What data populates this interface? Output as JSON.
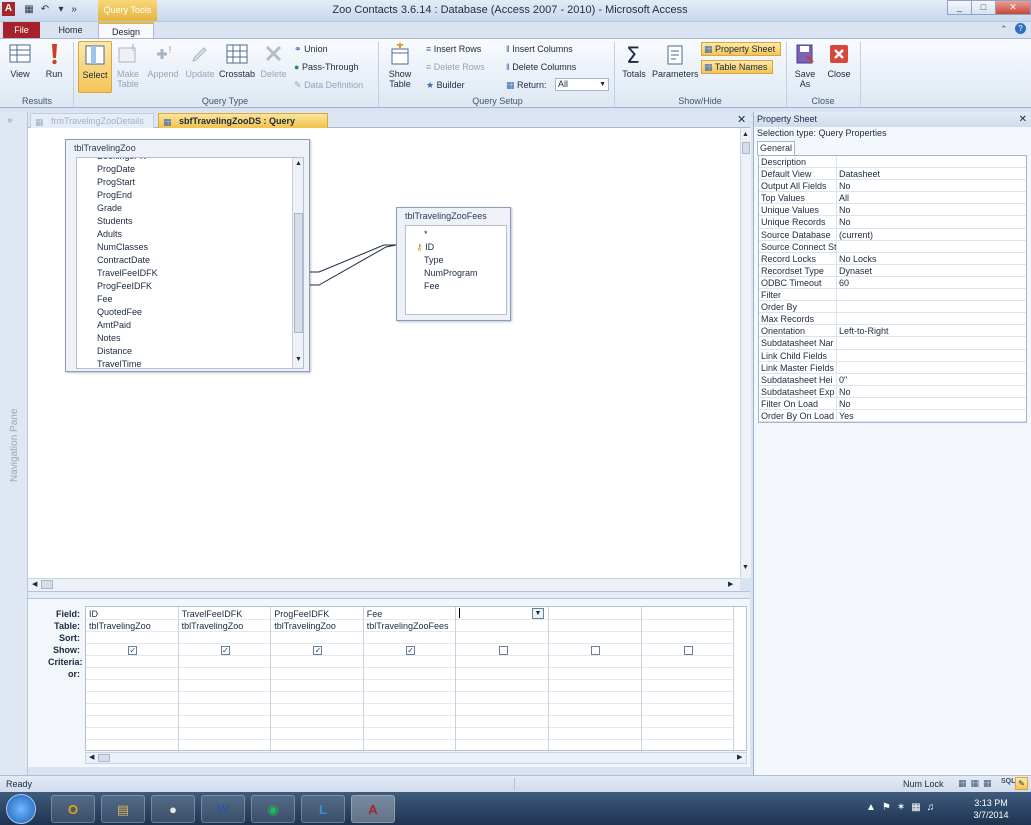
{
  "window": {
    "title": "Zoo Contacts 3.6.14 : Database (Access 2007 - 2010) - Microsoft Access",
    "context_label": "Query Tools",
    "app_letter": "A",
    "controls": [
      "_",
      "□",
      "✕"
    ]
  },
  "tabs": {
    "file": "File",
    "home": "Home",
    "design": "Design"
  },
  "ribbon": {
    "results": {
      "view": "View",
      "run": "Run",
      "group": "Results"
    },
    "query_type": {
      "select": "Select",
      "make_table": "Make Table",
      "append": "Append",
      "update": "Update",
      "crosstab": "Crosstab",
      "delete": "Delete",
      "union": "Union",
      "pass_through": "Pass-Through",
      "data_definition": "Data Definition",
      "group": "Query Type"
    },
    "query_setup": {
      "show_table": "Show Table",
      "insert_rows": "Insert Rows",
      "delete_rows": "Delete Rows",
      "builder": "Builder",
      "insert_columns": "Insert Columns",
      "delete_columns": "Delete Columns",
      "return_label": "Return:",
      "return_value": "All",
      "group": "Query Setup"
    },
    "show_hide": {
      "totals": "Totals",
      "parameters": "Parameters",
      "property_sheet": "Property Sheet",
      "table_names": "Table Names",
      "group": "Show/Hide"
    },
    "close": {
      "save_as": "Save As",
      "close": "Close",
      "group": "Close"
    }
  },
  "nav_pane_label": "Navigation Pane",
  "doc_tabs": [
    "frmTravelingZooDetails",
    "sbfTravelingZooDS : Query Builder"
  ],
  "table1": {
    "title": "tblTravelingZoo",
    "fields": [
      "BookingsPK",
      "ProgDate",
      "ProgStart",
      "ProgEnd",
      "Grade",
      "Students",
      "Adults",
      "NumClasses",
      "ContractDate",
      "TravelFeeIDFK",
      "ProgFeeIDFK",
      "Fee",
      "QuotedFee",
      "AmtPaid",
      "Notes",
      "Distance",
      "TravelTime"
    ]
  },
  "table2": {
    "title": "tblTravelingZooFees",
    "fields": [
      "*",
      "ID",
      "Type",
      "NumProgram",
      "Fee"
    ]
  },
  "grid": {
    "row_labels": [
      "Field:",
      "Table:",
      "Sort:",
      "Show:",
      "Criteria:",
      "or:"
    ],
    "columns": [
      {
        "field": "ID",
        "table": "tblTravelingZoo",
        "show": true
      },
      {
        "field": "TravelFeeIDFK",
        "table": "tblTravelingZoo",
        "show": true
      },
      {
        "field": "ProgFeeIDFK",
        "table": "tblTravelingZoo",
        "show": true
      },
      {
        "field": "Fee",
        "table": "tblTravelingZooFees",
        "show": true
      },
      {
        "field": "",
        "table": "",
        "show": false
      },
      {
        "field": "",
        "table": "",
        "show": false
      },
      {
        "field": "",
        "table": "",
        "show": false
      }
    ]
  },
  "property_sheet": {
    "title": "Property Sheet",
    "selection_type": "Selection type:  Query Properties",
    "tab": "General",
    "rows": [
      [
        "Description",
        ""
      ],
      [
        "Default View",
        "Datasheet"
      ],
      [
        "Output All Fields",
        "No"
      ],
      [
        "Top Values",
        "All"
      ],
      [
        "Unique Values",
        "No"
      ],
      [
        "Unique Records",
        "No"
      ],
      [
        "Source Database",
        "(current)"
      ],
      [
        "Source Connect St",
        ""
      ],
      [
        "Record Locks",
        "No Locks"
      ],
      [
        "Recordset Type",
        "Dynaset"
      ],
      [
        "ODBC Timeout",
        "60"
      ],
      [
        "Filter",
        ""
      ],
      [
        "Order By",
        ""
      ],
      [
        "Max Records",
        ""
      ],
      [
        "Orientation",
        "Left-to-Right"
      ],
      [
        "Subdatasheet Nar",
        ""
      ],
      [
        "Link Child Fields",
        ""
      ],
      [
        "Link Master Fields",
        ""
      ],
      [
        "Subdatasheet Hei",
        "0\""
      ],
      [
        "Subdatasheet Exp",
        "No"
      ],
      [
        "Filter On Load",
        "No"
      ],
      [
        "Order By On Load",
        "Yes"
      ]
    ]
  },
  "status": {
    "left": "Ready",
    "num_lock": "Num Lock",
    "sql": "SQL"
  },
  "taskbar": {
    "apps": [
      "Outlook",
      "Explorer",
      "Chrome",
      "Word",
      "Spotify",
      "Lync",
      "Access"
    ],
    "time": "3:13 PM",
    "date": "3/7/2014"
  },
  "colors": {
    "file_tab": "#a7202b",
    "highlight": "#f2c24a"
  }
}
